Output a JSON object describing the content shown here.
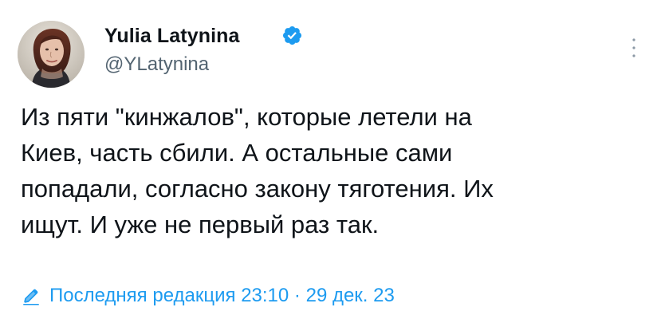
{
  "author": {
    "name": "Yulia Latynina",
    "handle": "@YLatynina",
    "verified_color": "#1d9bf0"
  },
  "icons": {
    "avatar": "profile-photo",
    "verified": "verified-badge-icon",
    "more": "more-vertical-icon",
    "edit": "pencil-icon"
  },
  "tweet": {
    "lines": [
      "Из пяти \"кинжалов\", которые летели на",
      "Киев, часть сбили. А остальные сами",
      "попадали, согласно закону тяготения. Их",
      "ищут. И уже не первый раз так."
    ]
  },
  "edit_info": {
    "label": "Последняя редакция",
    "time": "23:10",
    "separator": "·",
    "date": "29 дек. 23"
  },
  "colors": {
    "text": "#0f1419",
    "secondary": "#536471",
    "link": "#1d9bf0",
    "background": "#ffffff"
  }
}
